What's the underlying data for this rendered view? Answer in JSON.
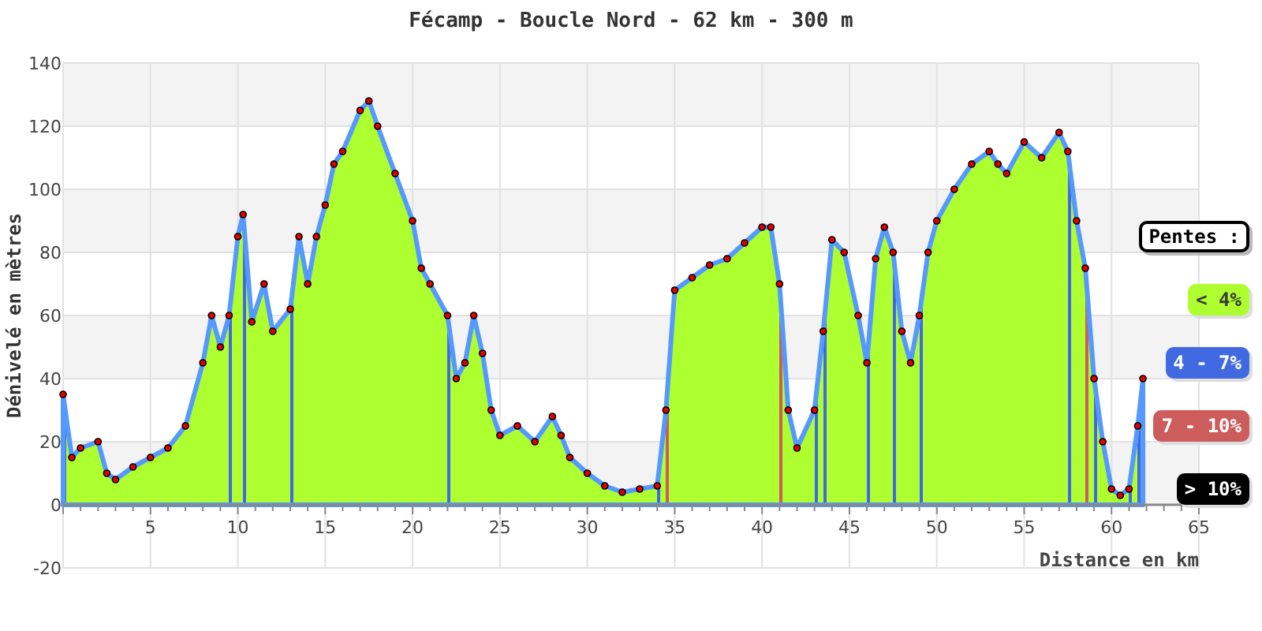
{
  "chart": {
    "chart_data": {
      "type": "area",
      "title": "Fécamp - Boucle Nord - 62 km - 300 m",
      "xlabel": "Distance en km",
      "ylabel": "Dénivelé en mètres",
      "x": [
        0,
        0.5,
        1,
        2,
        2.5,
        3,
        4,
        5,
        6,
        7,
        8,
        8.5,
        9,
        9.5,
        10,
        10.3,
        10.8,
        11.5,
        12,
        13,
        13.5,
        14,
        14.5,
        15,
        15.5,
        16,
        17,
        17.5,
        18,
        19,
        20,
        20.5,
        21,
        22,
        22.5,
        23,
        23.5,
        24,
        24.5,
        25,
        26,
        27,
        28,
        28.5,
        29,
        30,
        31,
        32,
        33,
        34,
        34.5,
        35,
        36,
        37,
        38,
        39,
        40,
        40.5,
        41,
        41.5,
        42,
        43,
        43.5,
        44,
        44.7,
        45.5,
        46,
        46.5,
        47,
        47.5,
        48,
        48.5,
        49,
        49.5,
        50,
        51,
        52,
        53,
        53.5,
        54,
        55,
        56,
        57,
        57.5,
        58,
        58.5,
        59,
        59.5,
        60,
        60.5,
        61,
        61.5,
        61.8
      ],
      "series": [
        {
          "color": "#5599ff",
          "values": [
            35,
            15,
            18,
            20,
            10,
            8,
            12,
            15,
            18,
            25,
            45,
            60,
            50,
            60,
            85,
            92,
            58,
            70,
            55,
            62,
            85,
            70,
            85,
            95,
            108,
            112,
            125,
            128,
            120,
            105,
            90,
            75,
            70,
            60,
            40,
            45,
            60,
            48,
            30,
            22,
            25,
            20,
            28,
            22,
            15,
            10,
            6,
            4,
            5,
            6,
            30,
            68,
            72,
            76,
            78,
            83,
            88,
            88,
            70,
            30,
            18,
            30,
            55,
            84,
            80,
            60,
            45,
            78,
            88,
            80,
            55,
            45,
            60,
            80,
            90,
            100,
            108,
            112,
            108,
            105,
            115,
            110,
            118,
            112,
            90,
            75,
            40,
            20,
            5,
            3,
            5,
            25,
            40
          ]
        }
      ],
      "grid": true,
      "xlim": [
        0,
        65
      ],
      "ylim": [
        -20,
        140
      ],
      "xticks": [
        {
          "value": 5,
          "label": "5"
        },
        {
          "value": 10,
          "label": "10"
        },
        {
          "value": 15,
          "label": "15"
        },
        {
          "value": 20,
          "label": "20"
        },
        {
          "value": 25,
          "label": "25"
        },
        {
          "value": 30,
          "label": "30"
        },
        {
          "value": 35,
          "label": "35"
        },
        {
          "value": 40,
          "label": "40"
        },
        {
          "value": 45,
          "label": "45"
        },
        {
          "value": 50,
          "label": "50"
        },
        {
          "value": 55,
          "label": "55"
        },
        {
          "value": 60,
          "label": "60"
        },
        {
          "value": 65,
          "label": "65"
        }
      ],
      "yticks": [
        {
          "value": -20,
          "label": "-20"
        },
        {
          "value": 0,
          "label": "0"
        },
        {
          "value": 20,
          "label": "20"
        },
        {
          "value": 40,
          "label": "40"
        },
        {
          "value": 60,
          "label": "60"
        },
        {
          "value": 80,
          "label": "80"
        },
        {
          "value": 100,
          "label": "100"
        },
        {
          "value": 120,
          "label": "120"
        },
        {
          "value": 140,
          "label": "140"
        }
      ]
    },
    "legend": {
      "title": "Pentes :",
      "items": [
        {
          "label": "< 4%",
          "color": "#adff2f"
        },
        {
          "label": "4 - 7%",
          "color": "#4169e1"
        },
        {
          "label": "7 - 10%",
          "color": "#cd5c5c"
        },
        {
          "label": "> 10%",
          "color": "#000000"
        }
      ]
    }
  }
}
